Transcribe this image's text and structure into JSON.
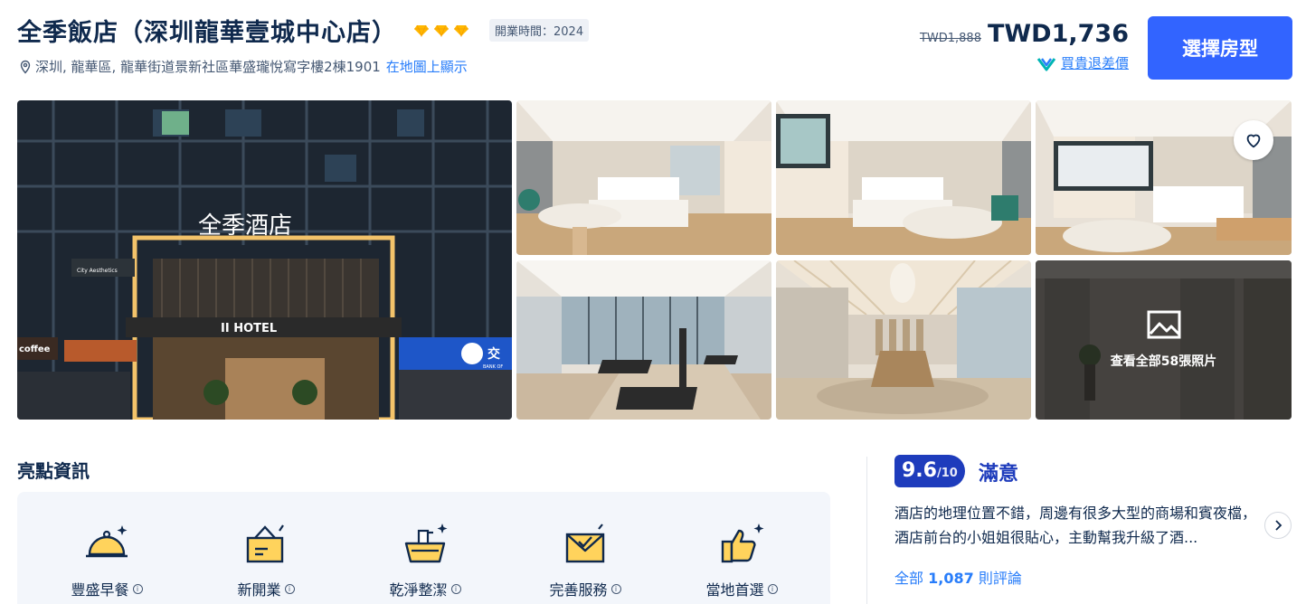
{
  "hotel": {
    "name": "全季飯店（深圳龍華壹城中心店）",
    "star_icon": "diamond-icon",
    "star_count": 3,
    "open_time": "開業時間：2024",
    "address": "深圳, 龍華區, 龍華街道景新社區華盛瓏悅寫字樓2棟1901",
    "map_link": "在地圖上顯示"
  },
  "price": {
    "original": "TWD1,888",
    "current": "TWD1,736",
    "guarantee": "買貴退差價"
  },
  "actions": {
    "select_room": "選擇房型"
  },
  "gallery": {
    "view_all": "查看全部58張照片",
    "building_sign": "全季酒店",
    "hotel_sign": "II HOTEL",
    "shop_sign_1": "City Aesthetics",
    "shop_sign_2": "coffee",
    "shop_sign_3": "交",
    "shop_sign_4": "BANK OF"
  },
  "highlights": {
    "title": "亮點資訊",
    "items": [
      {
        "label": "豐盛早餐",
        "icon": "breakfast-cloche-icon"
      },
      {
        "label": "新開業",
        "icon": "new-open-sign-icon"
      },
      {
        "label": "乾淨整潔",
        "icon": "cleaning-basket-icon"
      },
      {
        "label": "完善服務",
        "icon": "service-envelope-icon"
      },
      {
        "label": "當地首選",
        "icon": "thumbs-up-icon"
      }
    ],
    "info_glyph": "i"
  },
  "reviews": {
    "score": "9.6",
    "score_max": "/10",
    "rating_word": "滿意",
    "snippet": "酒店的地理位置不錯，周邊有很多大型的商場和賓夜檔，酒店前台的小姐姐很貼心，主動幫我升級了酒...",
    "count_prefix": "全部",
    "count": "1,087",
    "count_suffix": "則評論"
  },
  "colors": {
    "brand_blue": "#3264ff",
    "link_blue": "#287dfa",
    "score_blue": "#1e3cbc",
    "diamond_gold": "#ffb800",
    "text_dark": "#0f294d"
  }
}
